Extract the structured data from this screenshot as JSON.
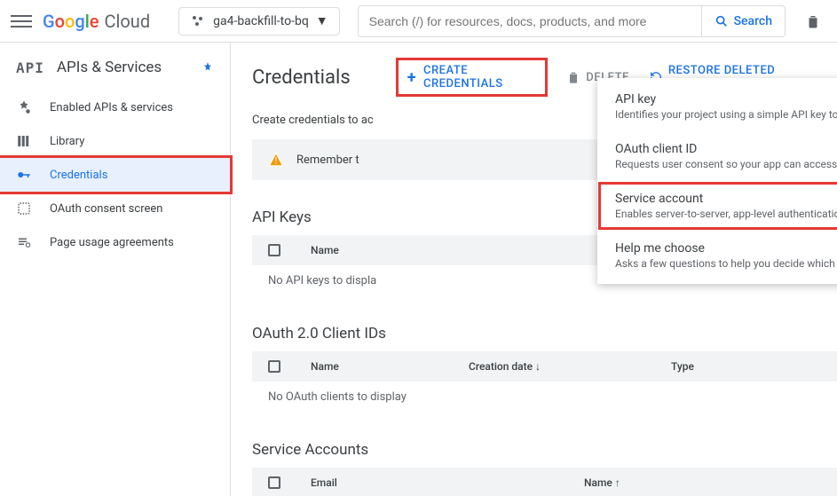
{
  "topbar": {
    "logo_google": "Google",
    "logo_cloud": "Cloud",
    "project_name": "ga4-backfill-to-bq",
    "search_placeholder": "Search (/) for resources, docs, products, and more",
    "search_button": "Search"
  },
  "sidebar": {
    "api_label": "API",
    "title": "APIs & Services",
    "items": [
      {
        "label": "Enabled APIs & services"
      },
      {
        "label": "Library"
      },
      {
        "label": "Credentials"
      },
      {
        "label": "OAuth consent screen"
      },
      {
        "label": "Page usage agreements"
      }
    ]
  },
  "main": {
    "title": "Credentials",
    "create_button": "CREATE CREDENTIALS",
    "delete_button": "DELETE",
    "restore_button": "RESTORE DELETED CREDENTIALS",
    "intro": "Create credentials to ac",
    "alert": "Remember t",
    "sections": {
      "api_keys": {
        "title": "API Keys",
        "col_name": "Name",
        "empty": "No API keys to displa"
      },
      "oauth": {
        "title": "OAuth 2.0 Client IDs",
        "col_name": "Name",
        "col_created": "Creation date",
        "col_type": "Type",
        "empty": "No OAuth clients to display"
      },
      "service": {
        "title": "Service Accounts",
        "col_email": "Email",
        "col_name": "Name"
      }
    }
  },
  "dropdown": {
    "items": [
      {
        "title": "API key",
        "sub": "Identifies your project using a simple API key to check quota and access"
      },
      {
        "title": "OAuth client ID",
        "sub": "Requests user consent so your app can access the user's data"
      },
      {
        "title": "Service account",
        "sub": "Enables server-to-server, app-level authentication using robot accounts"
      },
      {
        "title": "Help me choose",
        "sub": "Asks a few questions to help you decide which type of credential to use"
      }
    ]
  }
}
